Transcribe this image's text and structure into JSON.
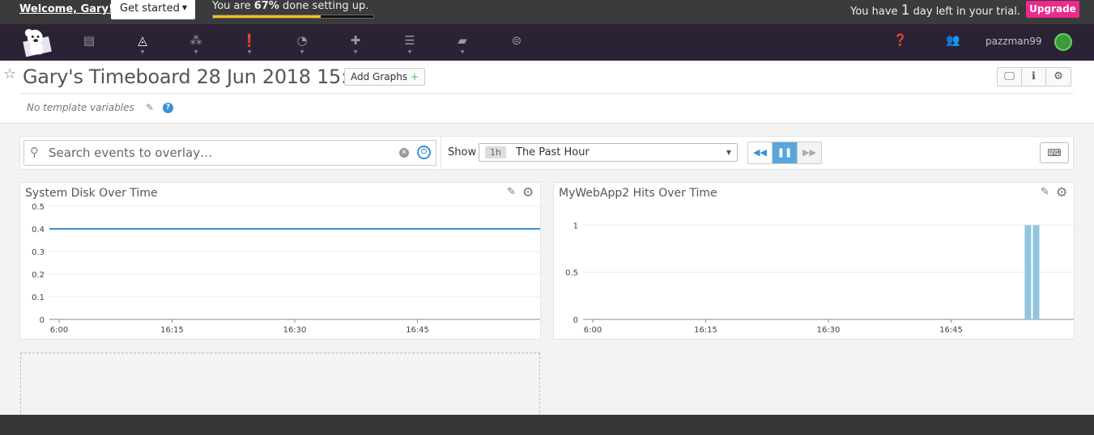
{
  "trialbar": {
    "welcome": "Welcome, Gary!",
    "get_started": "Get started",
    "progress_prefix": "You are",
    "progress_percent": "67%",
    "progress_suffix": "done setting up.",
    "progress_value": 0.67,
    "trial_prefix": "You have",
    "trial_days": "1",
    "trial_suffix": "day left in your trial.",
    "upgrade": "Upgrade",
    "colors": {
      "upgrade": "#ea2a8c",
      "progress": "#f2c21c"
    }
  },
  "nav": {
    "icons": [
      "logo-dog-icon",
      "events-icon",
      "dashboards-icon",
      "infrastructure-icon",
      "monitors-icon",
      "metrics-icon",
      "integrations-icon",
      "logs-icon",
      "notebooks-icon",
      "watchdog-icon",
      "help-icon",
      "team-icon"
    ],
    "username": "pazzman99"
  },
  "header": {
    "title": "Gary's Timeboard 28 Jun 2018 15:53",
    "add_graphs": "Add Graphs",
    "no_template_vars": "No template variables"
  },
  "toolbar": {
    "search_placeholder": "Search events to overlay…",
    "show_label": "Show",
    "time_pill": "1h",
    "time_label": "The Past Hour"
  },
  "graphs": [
    {
      "title": "System Disk Over Time"
    },
    {
      "title": "MyWebApp2 Hits Over Time"
    }
  ],
  "chart_data": [
    {
      "type": "line",
      "title": "System Disk Over Time",
      "x_ticks": [
        "6:00",
        "16:15",
        "16:30",
        "16:45"
      ],
      "y_ticks": [
        "0",
        "0.1",
        "0.2",
        "0.3",
        "0.4",
        "0.5"
      ],
      "ylim": [
        0,
        0.5
      ],
      "series": [
        {
          "x": [
            0,
            60
          ],
          "values": [
            0.4,
            0.4
          ]
        }
      ],
      "x_range_minutes": [
        0,
        60
      ],
      "color": "#3d8fd1"
    },
    {
      "type": "bar",
      "title": "MyWebApp2 Hits Over Time",
      "x_ticks": [
        "6:00",
        "16:15",
        "16:30",
        "16:45"
      ],
      "y_ticks": [
        "0",
        "0.5",
        "1"
      ],
      "ylim": [
        0,
        1.2
      ],
      "bars": [
        {
          "x": 54,
          "value": 1
        },
        {
          "x": 55,
          "value": 1
        }
      ],
      "x_range_minutes": [
        0,
        60
      ],
      "color": "#92c5e0"
    }
  ]
}
